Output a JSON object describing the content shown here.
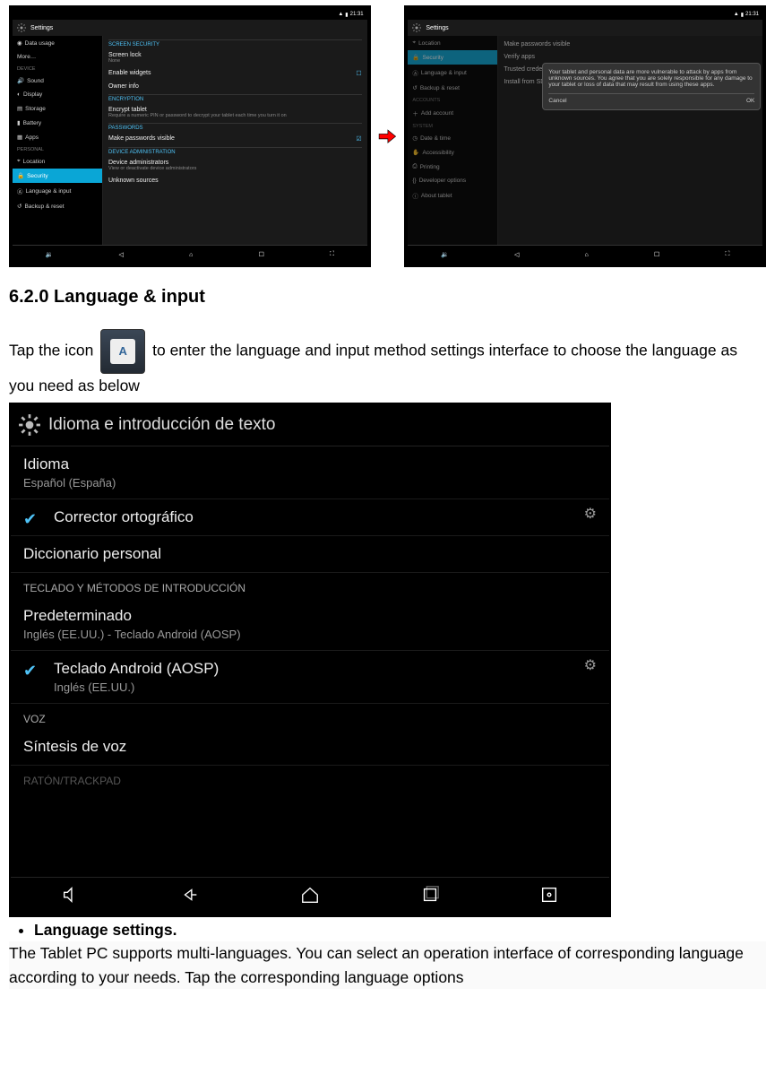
{
  "doc": {
    "heading": "6.2.0 Language & input",
    "intro_before": "Tap the icon ",
    "intro_after": " to enter the language and input method settings interface to choose the language as you need as below",
    "bullet": "Language settings.",
    "footer": "The Tablet PC supports multi-languages. You can select an operation interface of corresponding language according to your needs. Tap the corresponding language options"
  },
  "shot1": {
    "title": "Settings",
    "time": "21:31",
    "sidebar_cat1": "DEVICE",
    "sidebar_cat2": "PERSONAL",
    "items": {
      "dataUsage": "Data usage",
      "more": "More…",
      "sound": "Sound",
      "display": "Display",
      "storage": "Storage",
      "battery": "Battery",
      "apps": "Apps",
      "location": "Location",
      "security": "Security",
      "language": "Language & input",
      "backup": "Backup & reset"
    },
    "content": {
      "sec_screen": "SCREEN SECURITY",
      "screen_lock": "Screen lock",
      "screen_lock_sub": "None",
      "enable_widgets": "Enable widgets",
      "owner_info": "Owner info",
      "sec_encryption": "ENCRYPTION",
      "encrypt_tablet": "Encrypt tablet",
      "encrypt_tablet_sub": "Require a numeric PIN or password to decrypt your tablet each time you turn it on",
      "sec_passwords": "PASSWORDS",
      "make_visible": "Make passwords visible",
      "sec_deviceadmin": "DEVICE ADMINISTRATION",
      "device_admins": "Device administrators",
      "device_admins_sub": "View or deactivate device administrators",
      "unknown_sources": "Unknown sources"
    }
  },
  "shot2": {
    "title": "Settings",
    "time": "21:31",
    "dialog": {
      "text": "Your tablet and personal data are more vulnerable to attack by apps from unknown sources. You agree that you are solely responsible for any damage to your tablet or loss of data that may result from using these apps.",
      "cancel": "Cancel",
      "ok": "OK"
    },
    "items": {
      "security": "Security",
      "location": "Location",
      "language": "Language & input",
      "backup": "Backup & reset",
      "addaccount": "Add account",
      "datetime": "Date & time",
      "accessibility": "Accessibility",
      "printing": "Printing",
      "developer": "Developer options",
      "about": "About tablet"
    },
    "content": {
      "make_visible": "Make passwords visible",
      "verify_apps": "Verify apps",
      "trusted_cred": "Trusted credentials",
      "install_sd": "Install from SD card"
    }
  },
  "bigshot": {
    "title": "Idioma e introducción de texto",
    "items": {
      "idioma": "Idioma",
      "idioma_sub": "Español (España)",
      "corrector": "Corrector ortográfico",
      "diccionario": "Diccionario personal",
      "cat_keyboard": "TECLADO Y MÉTODOS DE INTRODUCCIÓN",
      "predet": "Predeterminado",
      "predet_sub": "Inglés (EE.UU.) - Teclado Android (AOSP)",
      "teclado": "Teclado Android (AOSP)",
      "teclado_sub": "Inglés (EE.UU.)",
      "cat_voz": "VOZ",
      "sintesis": "Síntesis de voz",
      "cat_raton": "RATÓN/TRACKPAD"
    }
  }
}
